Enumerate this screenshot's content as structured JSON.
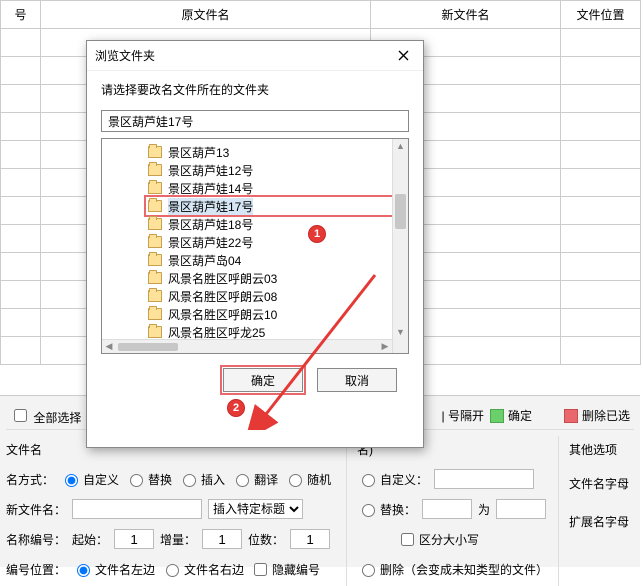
{
  "table": {
    "cols": [
      "号",
      "原文件名",
      "新文件名",
      "文件位置"
    ]
  },
  "dialog": {
    "title": "浏览文件夹",
    "prompt": "请选择要改名文件所在的文件夹",
    "path_value": "景区葫芦娃17号",
    "tree_items": [
      "景区葫芦13",
      "景区葫芦娃12号",
      "景区葫芦娃14号",
      "景区葫芦娃17号",
      "景区葫芦娃18号",
      "景区葫芦娃22号",
      "景区葫芦岛04",
      "风景名胜区呼朗云03",
      "风景名胜区呼朗云08",
      "风景名胜区呼朗云10",
      "风景名胜区呼龙25"
    ],
    "selected_index": 3,
    "ok": "确定",
    "cancel": "取消"
  },
  "annotations": {
    "badge1": "1",
    "badge2": "2"
  },
  "header_bar": {
    "select_all": "全部选择",
    "sep_label": "| 号隔开",
    "confirm": "确定",
    "delete_sel": "删除已选"
  },
  "panel": {
    "filename_label": "文件名",
    "name_right_label": "名)",
    "other_opt": "其他选项",
    "naming_mode_label": "名方式：",
    "mode_custom": "自定义",
    "mode_replace": "替换",
    "mode_insert": "插入",
    "mode_translate": "翻译",
    "mode_random": "随机",
    "newname_label": "新文件名：",
    "insert_title": "插入特定标题",
    "name_num_label": "名称编号：",
    "start_label": "起始：",
    "start_val": "1",
    "step_label": "增量：",
    "step_val": "1",
    "digits_label": "位数：",
    "digits_val": "1",
    "pos_label": "编号位置：",
    "pos_left": "文件名左边",
    "pos_right": "文件名右边",
    "pos_hide": "隐藏编号",
    "r_custom": "自定义：",
    "r_replace": "替换：",
    "r_to": "为",
    "r_case": "区分大小写",
    "r_delete": "删除（会变成未知类型的文件）",
    "filename_suffix": "文件名字母",
    "ext_suffix": "扩展名字母"
  }
}
